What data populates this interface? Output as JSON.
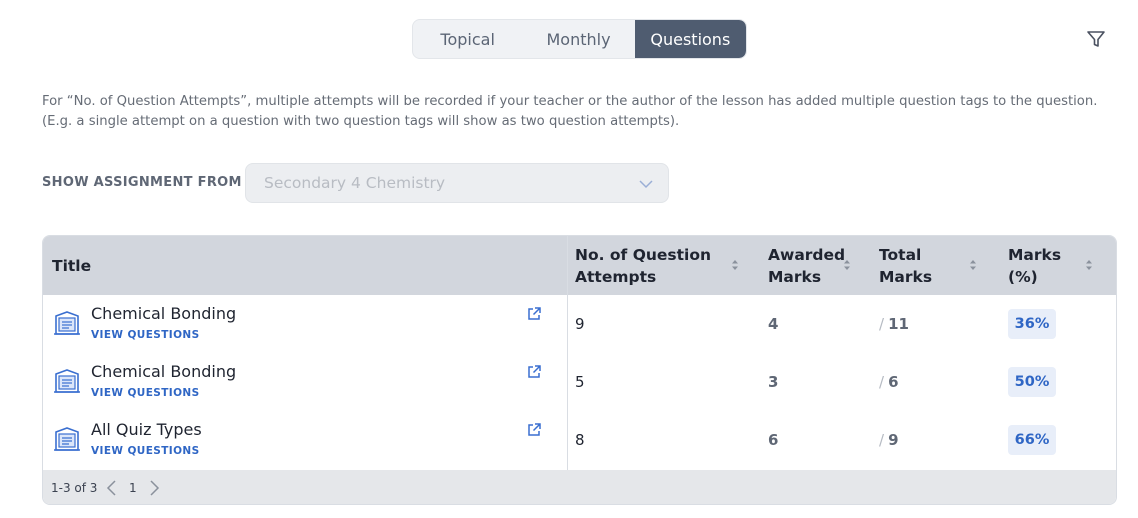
{
  "tabs": [
    {
      "label": "Topical",
      "active": false
    },
    {
      "label": "Monthly",
      "active": false
    },
    {
      "label": "Questions",
      "active": true
    }
  ],
  "icons": {
    "filter": "filter-icon",
    "dropdown": "chevron-down-icon",
    "lesson": "lesson-book-icon",
    "open": "external-link-icon",
    "sort": "sort-icon",
    "prev": "chevron-left-icon",
    "next": "chevron-right-icon"
  },
  "note": {
    "line1": "For “No. of Question Attempts”, multiple attempts will be recorded if your teacher or the author of the lesson has added multiple question tags to the question.",
    "line2": "(E.g. a single attempt on a question with two question tags will show as two question attempts)."
  },
  "filter_bar": {
    "label": "SHOW ASSIGNMENT FROM",
    "selected": "Secondary 4 Chemistry"
  },
  "table": {
    "headers": {
      "title": "Title",
      "attempts_1": "No. of Question",
      "attempts_2": "Attempts",
      "awarded_1": "Awarded",
      "awarded_2": "Marks",
      "total_1": "Total",
      "total_2": "Marks",
      "marks_1": "Marks",
      "marks_2": "(%)"
    },
    "rows": [
      {
        "title": "Chemical Bonding",
        "link": "VIEW QUESTIONS",
        "attempts": "9",
        "awarded": "4",
        "total": "11",
        "pct": "36%"
      },
      {
        "title": "Chemical Bonding",
        "link": "VIEW QUESTIONS",
        "attempts": "5",
        "awarded": "3",
        "total": "6",
        "pct": "50%"
      },
      {
        "title": "All Quiz Types",
        "link": "VIEW QUESTIONS",
        "attempts": "8",
        "awarded": "6",
        "total": "9",
        "pct": "66%"
      }
    ]
  },
  "pagination": {
    "range": "1-3 of 3",
    "page": "1"
  },
  "colors": {
    "accent": "#2f66c5",
    "active_tab": "#4f5c70",
    "header_bg": "#d2d6dd"
  }
}
